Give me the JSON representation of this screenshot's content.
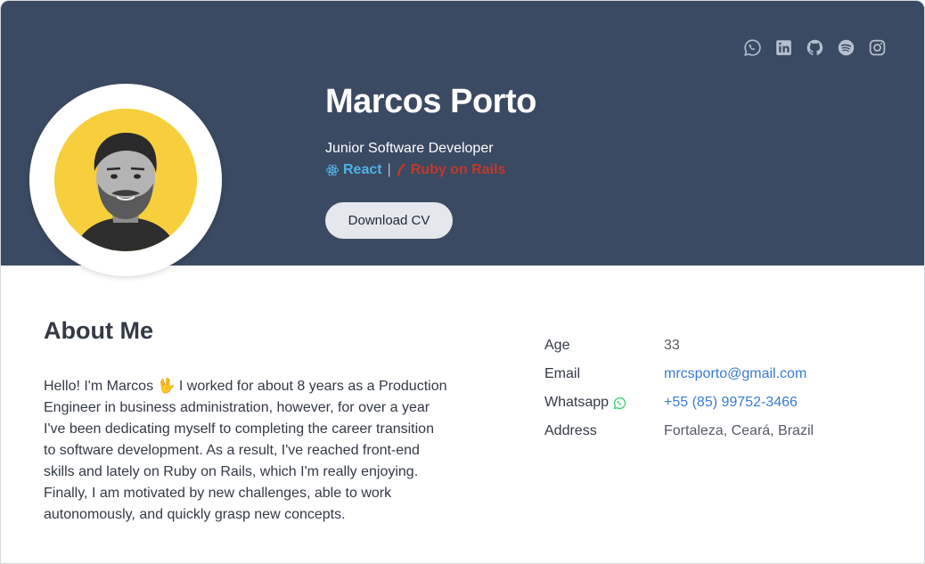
{
  "profile": {
    "name": "Marcos Porto",
    "role": "Junior Software Developer",
    "stack": {
      "react_label": "React",
      "separator": "|",
      "rails_label": "Ruby on Rails"
    },
    "download_label": "Download CV"
  },
  "social_icons": [
    "whatsapp-icon",
    "linkedin-icon",
    "github-icon",
    "spotify-icon",
    "instagram-icon"
  ],
  "about": {
    "title": "About Me",
    "text": "Hello! I'm Marcos 🖖 I worked for about 8 years as a Production Engineer in business administration, however, for over a year I've been dedicating myself to completing the career transition to software development. As a result, I've reached front-end skills and lately on Ruby on Rails, which I'm really enjoying. Finally, I am motivated by new challenges, able to work autonomously, and quickly grasp new concepts."
  },
  "info": {
    "age_label": "Age",
    "age_value": "33",
    "email_label": "Email",
    "email_value": "mrcsporto@gmail.com",
    "whatsapp_label": "Whatsapp",
    "whatsapp_value": "+55 (85) 99752-3466",
    "address_label": "Address",
    "address_value": "Fortaleza, Ceará, Brazil"
  },
  "colors": {
    "hero_bg": "#3a4a62",
    "react": "#4fb3e8",
    "rails": "#c0392b",
    "link": "#3a7bd5",
    "whatsapp": "#25d366"
  }
}
